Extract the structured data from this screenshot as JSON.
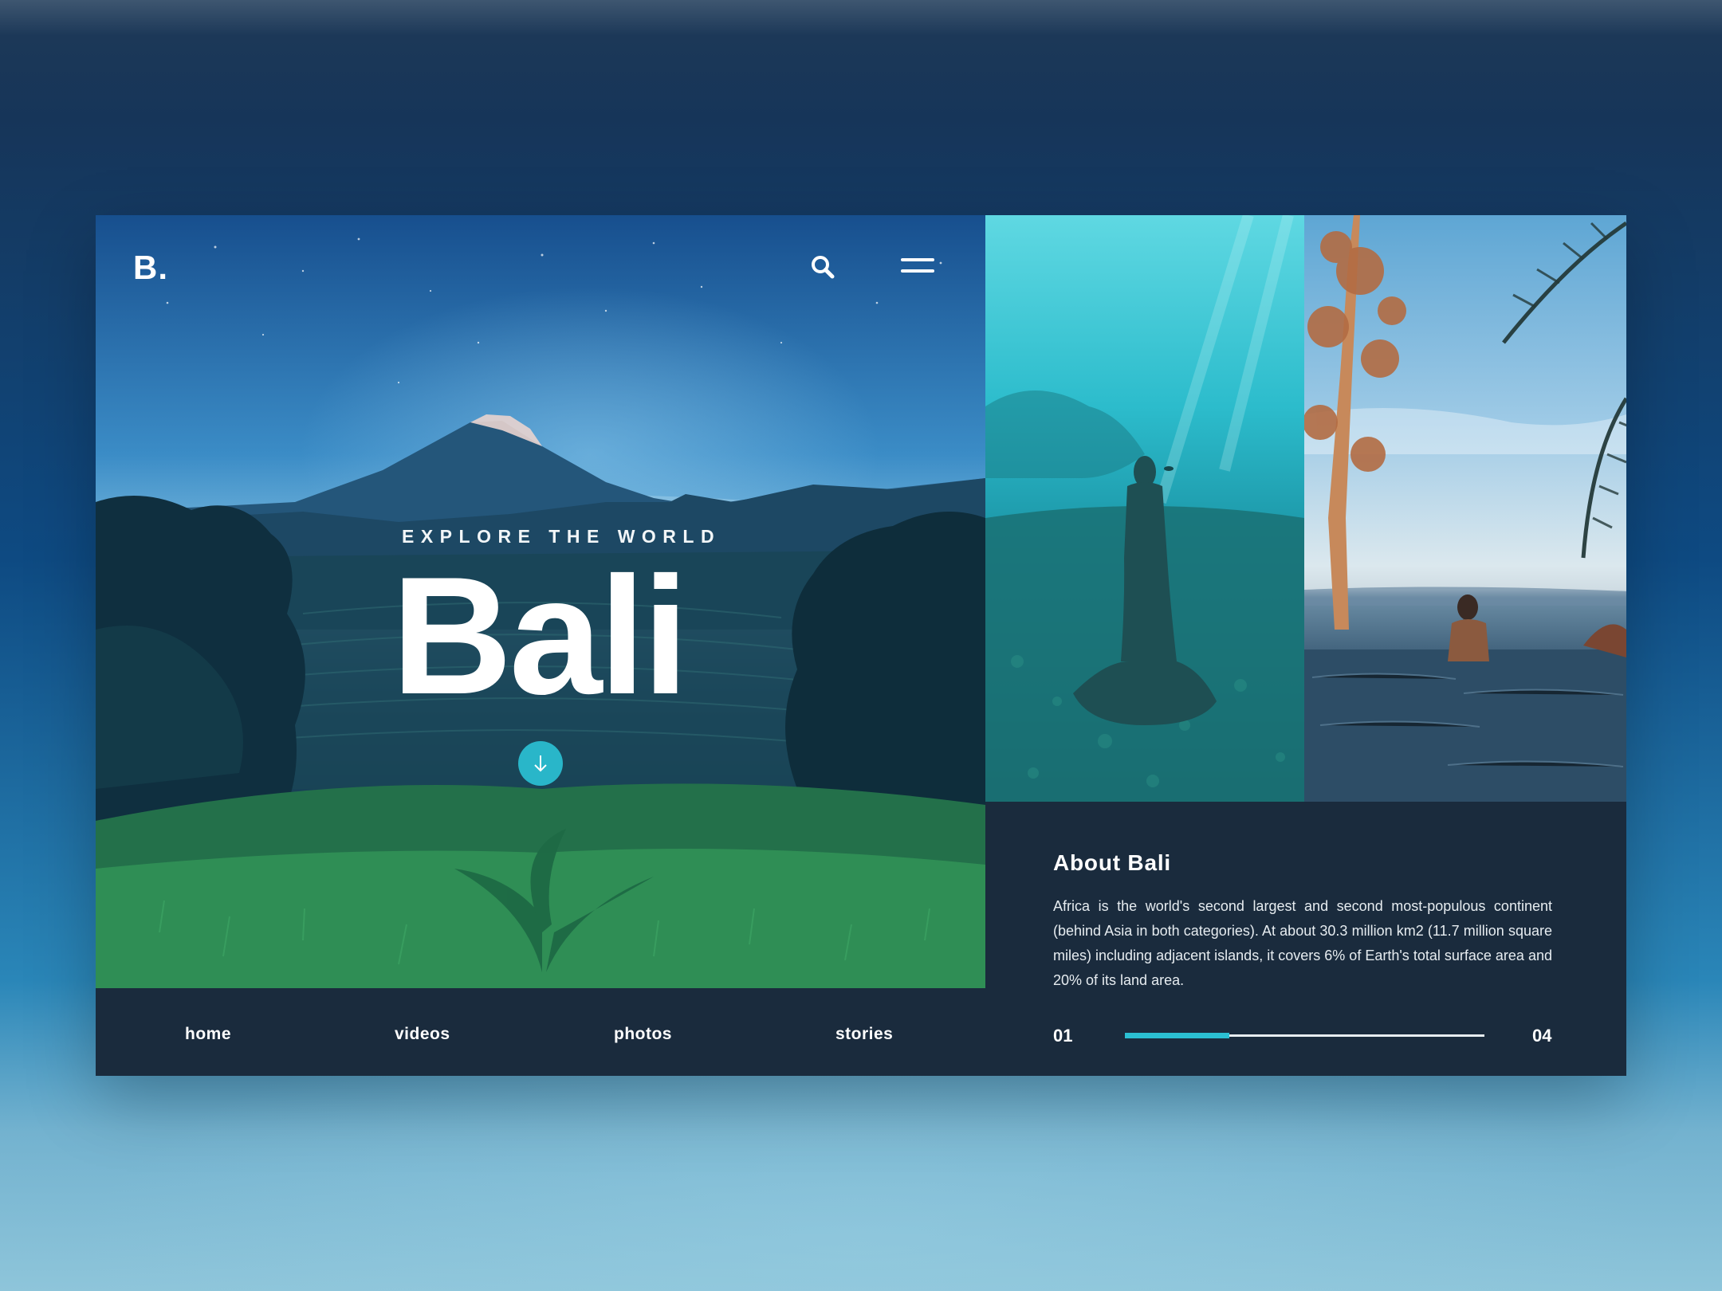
{
  "brand": {
    "logo": "B."
  },
  "header": {
    "search_icon": "search-icon",
    "menu_icon": "hamburger-menu-icon"
  },
  "hero": {
    "eyebrow": "EXPLORE THE WORLD",
    "title": "Bali",
    "scroll_icon": "arrow-down-icon"
  },
  "nav": {
    "items": [
      {
        "label": "home"
      },
      {
        "label": "videos"
      },
      {
        "label": "photos"
      },
      {
        "label": "stories"
      }
    ]
  },
  "about": {
    "title": "About Bali",
    "text": "Africa is the world's second largest and second most-populous continent (behind Asia in both categories). At about 30.3 million km2 (11.7 million square miles) including adjacent islands, it covers 6% of Earth's total surface area and 20% of its land area."
  },
  "slider": {
    "current": "01",
    "total": "04",
    "progress": 0.29
  },
  "colors": {
    "accent": "#2bbfd2",
    "panel": "#1a2b3d",
    "text": "#ffffff"
  }
}
